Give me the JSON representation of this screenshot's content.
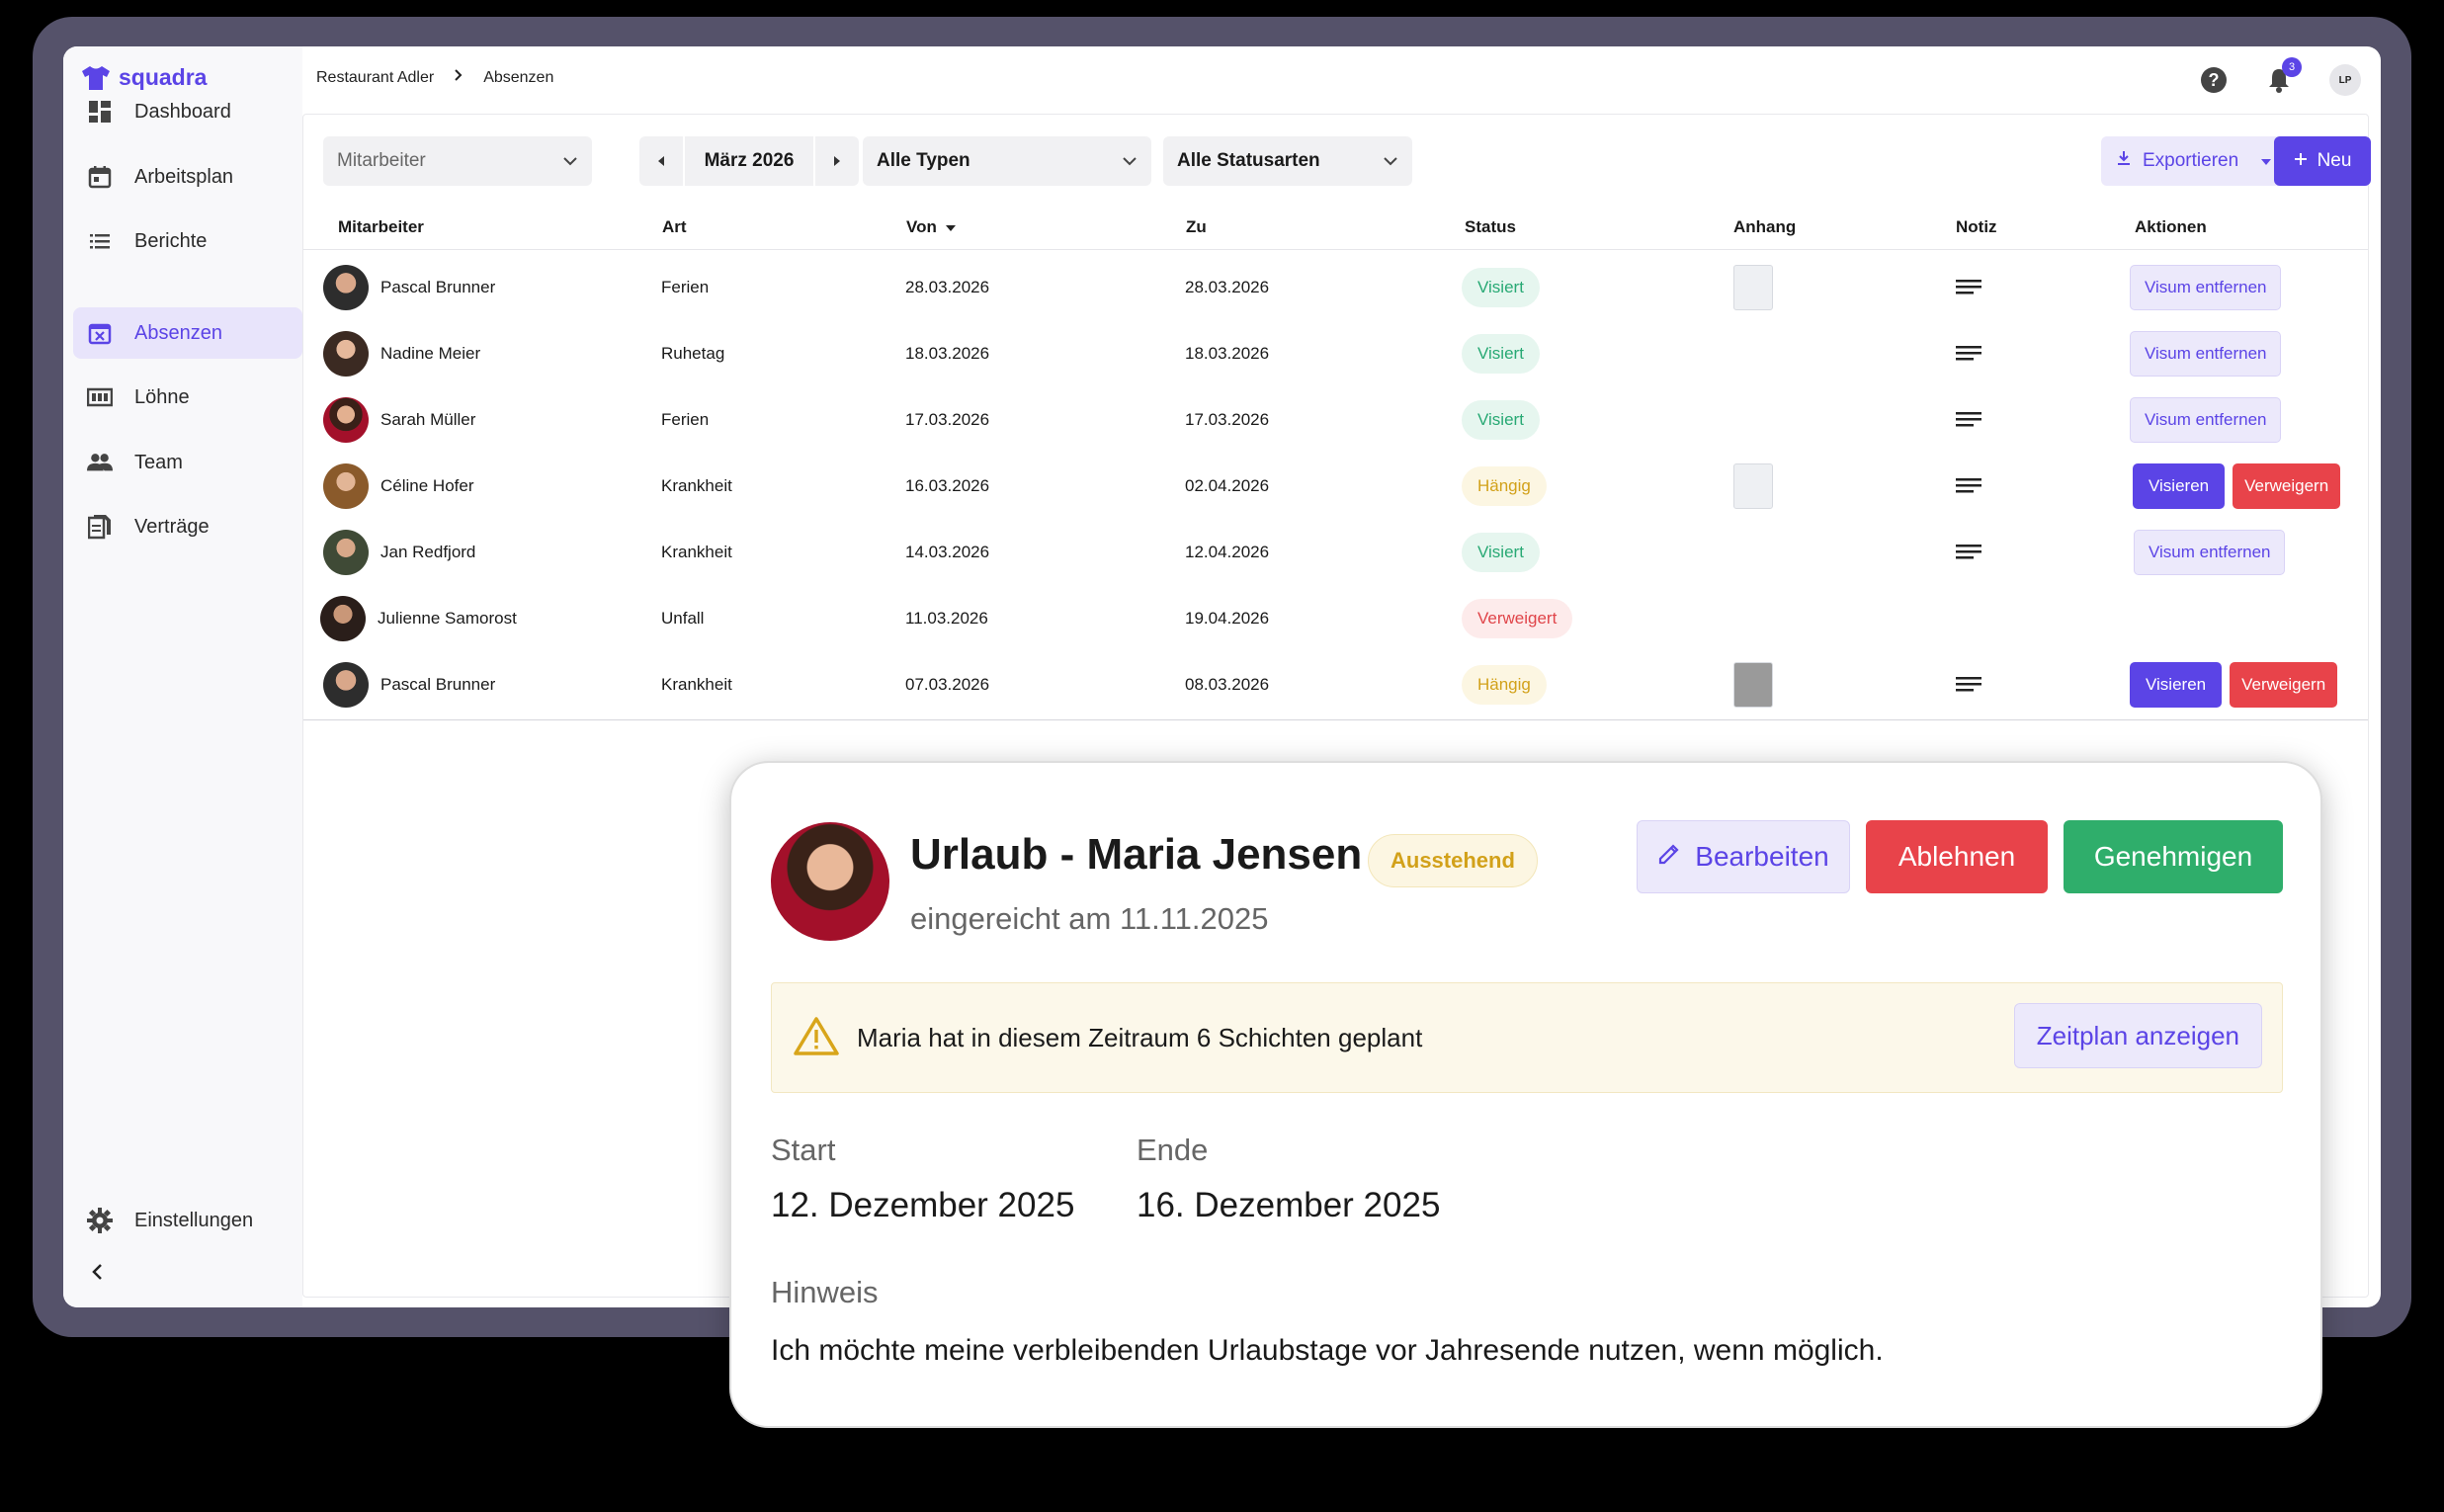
{
  "app": {
    "name": "squadra"
  },
  "sidebar": {
    "items": [
      {
        "label": "Dashboard",
        "icon": "dashboard-icon"
      },
      {
        "label": "Arbeitsplan",
        "icon": "calendar-icon"
      },
      {
        "label": "Berichte",
        "icon": "list-icon"
      },
      {
        "label": "Absenzen",
        "icon": "calendar-x-icon",
        "active": true
      },
      {
        "label": "Löhne",
        "icon": "payroll-icon"
      },
      {
        "label": "Team",
        "icon": "team-icon"
      },
      {
        "label": "Verträge",
        "icon": "contracts-icon"
      }
    ],
    "settings_label": "Einstellungen"
  },
  "breadcrumb": {
    "parent": "Restaurant Adler",
    "current": "Absenzen"
  },
  "topbar": {
    "notification_count": "3",
    "user_initials": "LP"
  },
  "filters": {
    "employee_placeholder": "Mitarbeiter",
    "month": "März 2026",
    "type": "Alle Typen",
    "status": "Alle Statusarten"
  },
  "actions": {
    "export_label": "Exportieren",
    "new_label": "Neu"
  },
  "table": {
    "columns": [
      "Mitarbeiter",
      "Art",
      "Von",
      "Zu",
      "Status",
      "Anhang",
      "Notiz",
      "Aktionen"
    ],
    "rows": [
      {
        "name": "Pascal Brunner",
        "art": "Ferien",
        "von": "28.03.2026",
        "zu": "28.03.2026",
        "status": "Visiert"
      },
      {
        "name": "Nadine Meier",
        "art": "Ruhetag",
        "von": "18.03.2026",
        "zu": "18.03.2026",
        "status": "Visiert"
      },
      {
        "name": "Sarah Müller",
        "art": "Ferien",
        "von": "17.03.2026",
        "zu": "17.03.2026",
        "status": "Visiert"
      },
      {
        "name": "Céline Hofer",
        "art": "Krankheit",
        "von": "16.03.2026",
        "zu": "02.04.2026",
        "status": "Hängig"
      },
      {
        "name": "Jan Redfjord",
        "art": "Krankheit",
        "von": "14.03.2026",
        "zu": "12.04.2026",
        "status": "Visiert"
      },
      {
        "name": "Julienne Samorost",
        "art": "Unfall",
        "von": "11.03.2026",
        "zu": "19.04.2026",
        "status": "Verweigert"
      },
      {
        "name": "Pascal Brunner",
        "art": "Krankheit",
        "von": "07.03.2026",
        "zu": "08.03.2026",
        "status": "Hängig"
      }
    ],
    "action_labels": {
      "remove": "Visum entfernen",
      "approve": "Visieren",
      "reject": "Verweigern"
    }
  },
  "detail": {
    "title": "Urlaub - Maria Jensen",
    "status": "Ausstehend",
    "submitted": "eingereicht am 11.11.2025",
    "edit_label": "Bearbeiten",
    "reject_label": "Ablehnen",
    "approve_label": "Genehmigen",
    "warning": "Maria hat in diesem Zeitraum 6 Schichten geplant",
    "schedule_label": "Zeitplan anzeigen",
    "start_label": "Start",
    "start_value": "12. Dezember 2025",
    "end_label": "Ende",
    "end_value": "16. Dezember 2025",
    "note_label": "Hinweis",
    "note_value": "Ich möchte meine verbleibenden Urlaubstage vor Jahresende nutzen, wenn möglich."
  },
  "colors": {
    "accent": "#5b44e6",
    "success": "#2fae6b",
    "danger": "#e8434a",
    "warning": "#d2a11a"
  }
}
